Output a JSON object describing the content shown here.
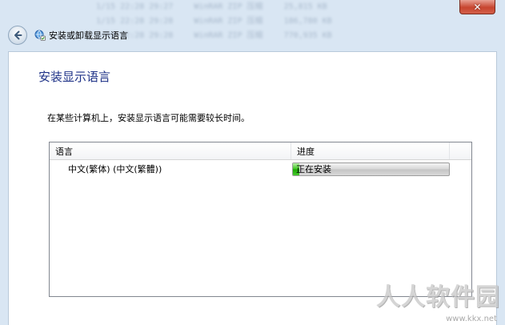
{
  "window": {
    "title": "安装或卸载显示语言",
    "close_glyph": "✕"
  },
  "background_rows": [
    [
      "1/15 22:28 29:27",
      "WinRAR ZIP 压缩",
      "25,815 KB"
    ],
    [
      "1/15 22:28 29:28",
      "WinRAR ZIP 压缩",
      "186,780 KB"
    ],
    [
      "1/15 22:28 29:28",
      "WinRAR ZIP 压缩",
      "770,935 KB"
    ]
  ],
  "page": {
    "title": "安装显示语言",
    "description": "在某些计算机上，安装显示语言可能需要较长时间。"
  },
  "list": {
    "columns": {
      "language": "语言",
      "progress": "进度"
    },
    "rows": [
      {
        "language": "中文(繁体) (中文(繁體))",
        "status": "正在安装",
        "progress_percent": 4
      }
    ]
  },
  "watermark": {
    "text": "人人软件园",
    "url": "www.kkx.net"
  },
  "colors": {
    "title": "#1e3287",
    "progress_green": "#19a800",
    "close_red": "#c7452f"
  },
  "icons": {
    "back": "back-arrow-icon",
    "app": "language-globe-icon"
  }
}
